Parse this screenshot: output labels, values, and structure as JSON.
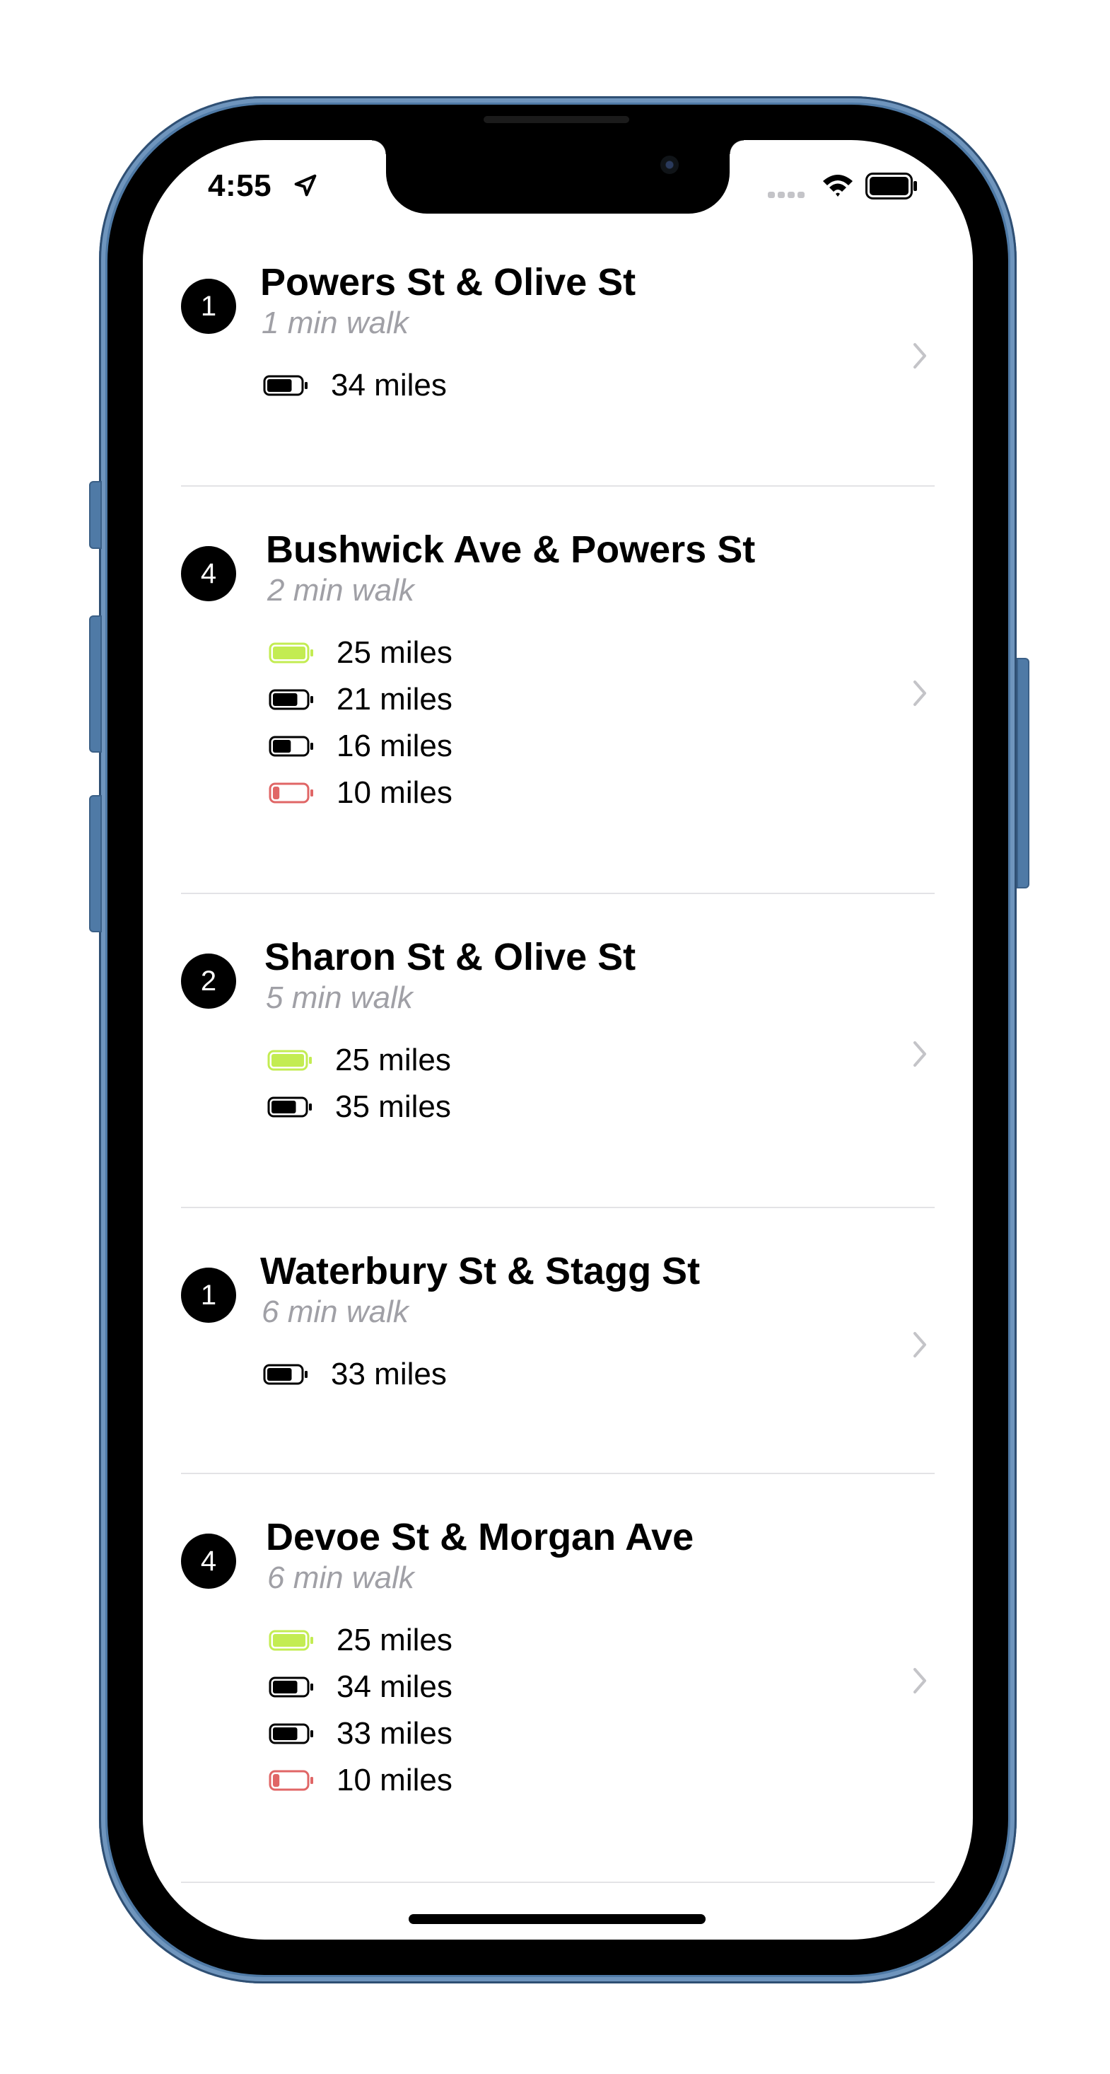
{
  "status_bar": {
    "time": "4:55"
  },
  "colors": {
    "full": "#c3ec52",
    "mid": "#000000",
    "low": "#e06666",
    "subtle": "#a0a0a6",
    "chevron": "#c4c4c8"
  },
  "stations": [
    {
      "count": "1",
      "name": "Powers St & Olive St",
      "walk": "1 min walk",
      "bikes": [
        {
          "range": "34 miles",
          "level": "mid",
          "fill": 0.75
        }
      ]
    },
    {
      "count": "4",
      "name": "Bushwick Ave & Powers St",
      "walk": "2 min walk",
      "bikes": [
        {
          "range": "25 miles",
          "level": "full",
          "fill": 1.0
        },
        {
          "range": "21 miles",
          "level": "mid",
          "fill": 0.75
        },
        {
          "range": "16 miles",
          "level": "mid",
          "fill": 0.55
        },
        {
          "range": "10 miles",
          "level": "low",
          "fill": 0.2
        }
      ]
    },
    {
      "count": "2",
      "name": "Sharon St & Olive St",
      "walk": "5 min walk",
      "bikes": [
        {
          "range": "25 miles",
          "level": "full",
          "fill": 1.0
        },
        {
          "range": "35 miles",
          "level": "mid",
          "fill": 0.75
        }
      ]
    },
    {
      "count": "1",
      "name": "Waterbury St & Stagg St",
      "walk": "6 min walk",
      "bikes": [
        {
          "range": "33 miles",
          "level": "mid",
          "fill": 0.75
        }
      ]
    },
    {
      "count": "4",
      "name": "Devoe St & Morgan Ave",
      "walk": "6 min walk",
      "bikes": [
        {
          "range": "25 miles",
          "level": "full",
          "fill": 1.0
        },
        {
          "range": "34 miles",
          "level": "mid",
          "fill": 0.75
        },
        {
          "range": "33 miles",
          "level": "mid",
          "fill": 0.75
        },
        {
          "range": "10 miles",
          "level": "low",
          "fill": 0.2
        }
      ]
    }
  ]
}
